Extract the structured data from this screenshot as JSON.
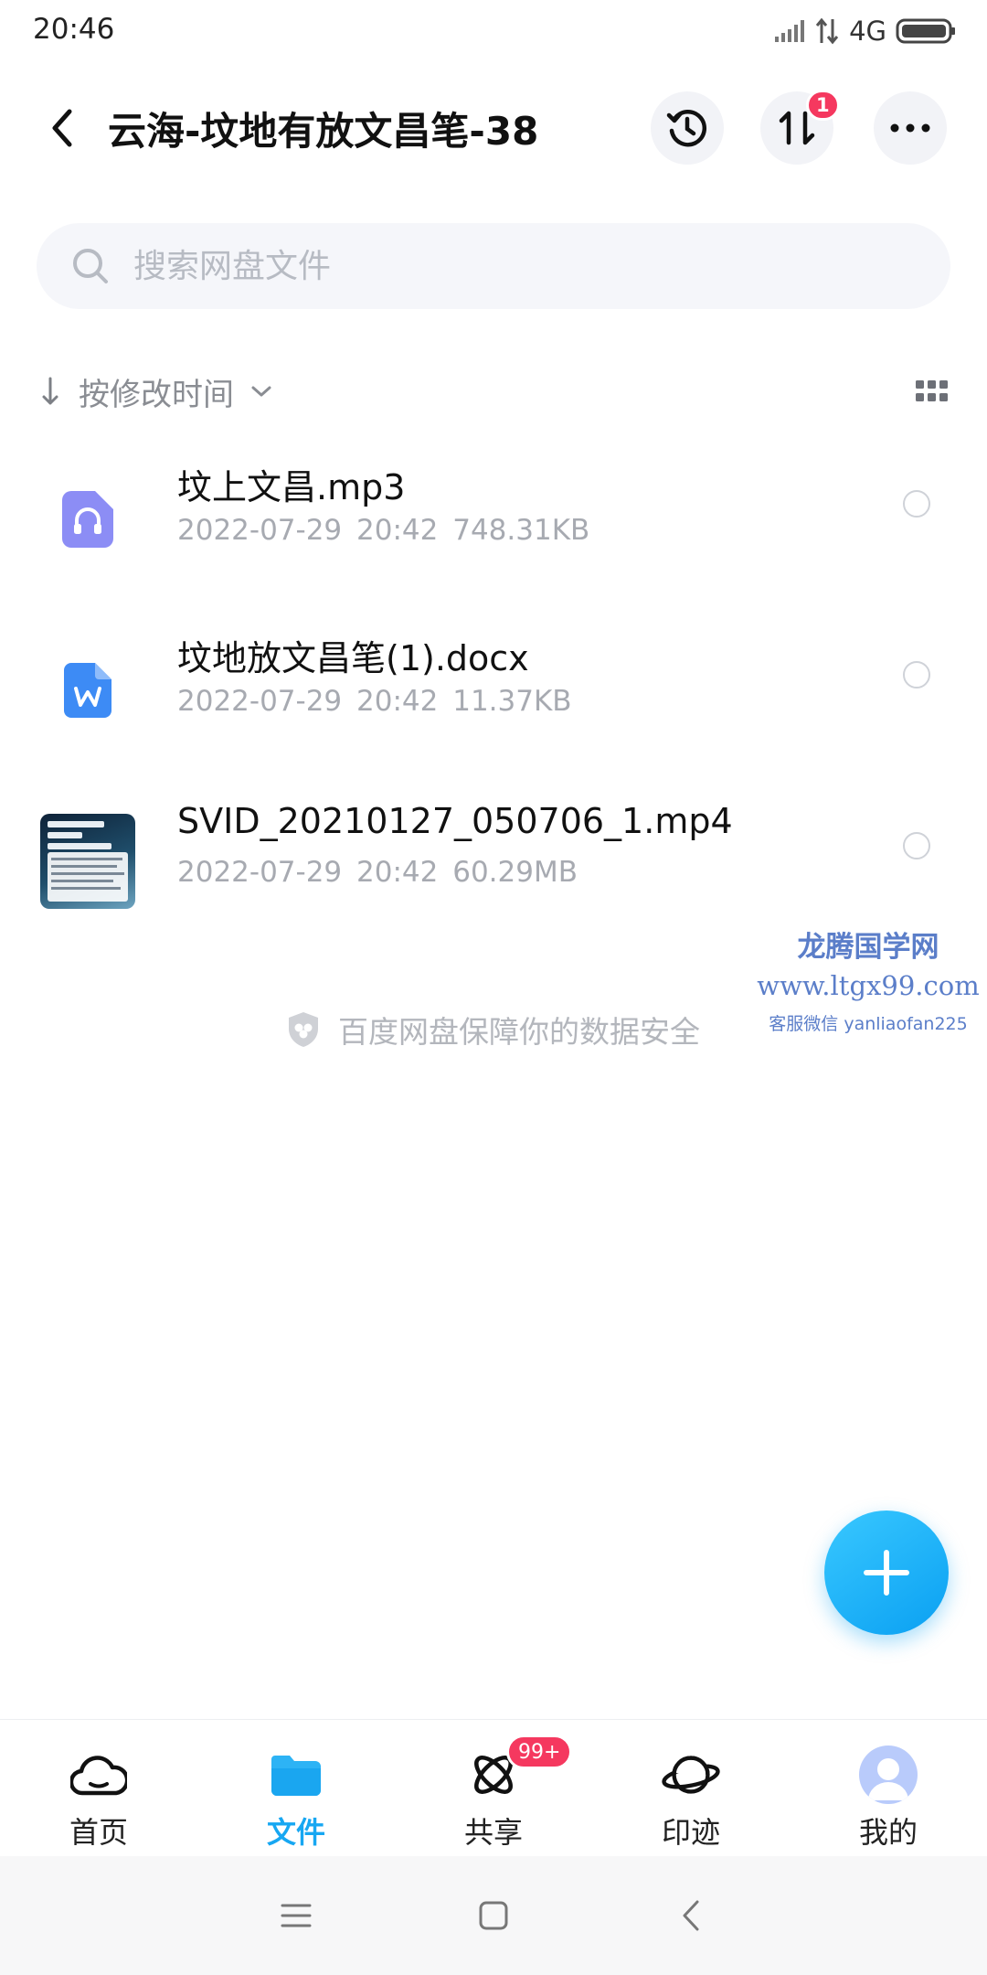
{
  "status_bar": {
    "time": "20:46",
    "network": "4G"
  },
  "header": {
    "title": "云海-坟地有放文昌笔-38",
    "transfer_badge": "1"
  },
  "search": {
    "placeholder": "搜索网盘文件"
  },
  "sort": {
    "label": "按修改时间"
  },
  "files": [
    {
      "name": "坟上文昌.mp3",
      "date": "2022-07-29",
      "time": "20:42",
      "size": "748.31KB",
      "icon": "audio-file-icon",
      "icon_color": "#8c8df5"
    },
    {
      "name": "坟地放文昌笔(1).docx",
      "date": "2022-07-29",
      "time": "20:42",
      "size": "11.37KB",
      "icon": "word-file-icon",
      "icon_color": "#3d8bf5"
    },
    {
      "name": "SVID_20210127_050706_1.mp4",
      "date": "2022-07-29",
      "time": "20:42",
      "size": "60.29MB",
      "icon": "video-thumbnail"
    }
  ],
  "watermark": {
    "title": "龙腾国学网",
    "url": "www.ltgx99.com",
    "contact": "客服微信 yanliaofan225"
  },
  "safety_note": "百度网盘保障你的数据安全",
  "bottom_nav": {
    "items": [
      {
        "label": "首页",
        "icon": "cloud-icon"
      },
      {
        "label": "文件",
        "icon": "folder-icon",
        "active": true
      },
      {
        "label": "共享",
        "icon": "atom-icon",
        "badge": "99+"
      },
      {
        "label": "印迹",
        "icon": "planet-icon"
      },
      {
        "label": "我的",
        "icon": "avatar"
      }
    ]
  },
  "colors": {
    "accent": "#17a7f2",
    "badge": "#f5385f",
    "muted_text": "#a7aab1"
  }
}
